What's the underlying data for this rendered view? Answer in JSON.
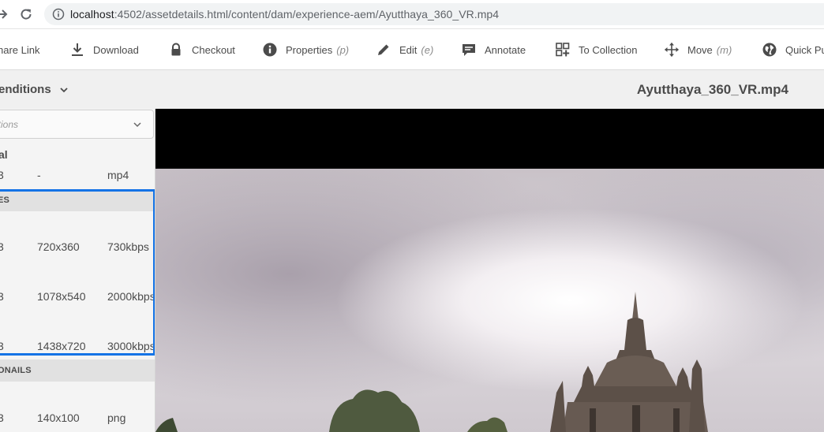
{
  "browser": {
    "url_host": "localhost",
    "url_path": ":4502/assetdetails.html/content/dam/experience-aem/Ayutthaya_360_VR.mp4"
  },
  "actions": [
    {
      "label": "hare Link",
      "key": "",
      "icon": "link-icon"
    },
    {
      "label": "Download",
      "key": "",
      "icon": "download-icon"
    },
    {
      "label": "Checkout",
      "key": "",
      "icon": "lock-icon"
    },
    {
      "label": "Properties",
      "key": "(p)",
      "icon": "info-icon"
    },
    {
      "label": "Edit",
      "key": "(e)",
      "icon": "pencil-icon"
    },
    {
      "label": "Annotate",
      "key": "",
      "icon": "comment-icon"
    },
    {
      "label": "To Collection",
      "key": "",
      "icon": "add-collection-icon"
    },
    {
      "label": "Move",
      "key": "(m)",
      "icon": "move-icon"
    },
    {
      "label": "Quick Pub",
      "key": "",
      "icon": "globe-icon"
    }
  ],
  "header": {
    "rail_title": "enditions",
    "asset_title": "Ayutthaya_360_VR.mp4"
  },
  "rail": {
    "select_placeholder": "itions",
    "original": {
      "label": "al",
      "row": {
        "c0": "3",
        "c1": "-",
        "c2": "mp4"
      }
    },
    "sections": [
      {
        "label": "ES",
        "rows": [
          {
            "c0": "3",
            "c1": "720x360",
            "c2": "730kbps"
          },
          {
            "c0": "3",
            "c1": "1078x540",
            "c2": "2000kbps"
          },
          {
            "c0": "3",
            "c1": "1438x720",
            "c2": "3000kbps"
          }
        ]
      },
      {
        "label": "ONAILS",
        "rows": [
          {
            "c0": "3",
            "c1": "140x100",
            "c2": "png"
          }
        ]
      }
    ]
  },
  "colors": {
    "selection": "#1473e6",
    "text": "#4b4b4b"
  }
}
